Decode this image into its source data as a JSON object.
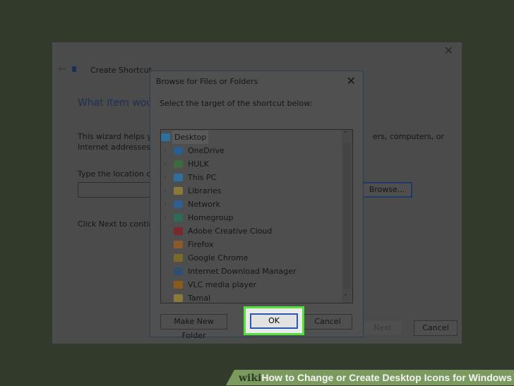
{
  "wizard": {
    "title": "Create Shortcut",
    "heading": "What item woul",
    "description": "This wizard helps you create shortcuts to local or network programs, files, folders, computers, or Internet addresses.",
    "desc_left": "This wizard helps you",
    "desc_right": "ers, computers, or",
    "desc_line2": "Internet addresses.",
    "location_label": "Type the location of",
    "browse": "Browse...",
    "click_next": "Click Next to continu",
    "next": "Next",
    "cancel": "Cancel"
  },
  "dialog": {
    "title": "Browse for Files or Folders",
    "prompt": "Select the target of the shortcut below:",
    "make_new_folder": "Make New Folder",
    "ok": "OK",
    "cancel": "Cancel",
    "items": [
      {
        "label": "Desktop",
        "expandable": false,
        "selected": true,
        "color": "#2e6f9e"
      },
      {
        "label": "OneDrive",
        "expandable": true,
        "color": "#2a5e8e"
      },
      {
        "label": "HULK",
        "expandable": true,
        "color": "#3c6a3c"
      },
      {
        "label": "This PC",
        "expandable": true,
        "color": "#2e6f9e"
      },
      {
        "label": "Libraries",
        "expandable": true,
        "color": "#8a7a3a"
      },
      {
        "label": "Network",
        "expandable": true,
        "color": "#2e5f8e"
      },
      {
        "label": "Homegroup",
        "expandable": true,
        "color": "#2e6a5a"
      },
      {
        "label": "Adobe Creative Cloud",
        "expandable": false,
        "color": "#7a2a2a"
      },
      {
        "label": "Firefox",
        "expandable": false,
        "color": "#8a5a2a"
      },
      {
        "label": "Google Chrome",
        "expandable": false,
        "color": "#7a6a2a"
      },
      {
        "label": "Internet Download Manager",
        "expandable": false,
        "color": "#2e4f6e"
      },
      {
        "label": "VLC media player",
        "expandable": false,
        "color": "#8a5a1a"
      },
      {
        "label": "Tamal",
        "expandable": false,
        "color": "#8a7a3a"
      }
    ]
  },
  "banner": {
    "wiki": "wiki",
    "how": "How",
    "title": " to Change or Create Desktop Icons for Windows"
  }
}
